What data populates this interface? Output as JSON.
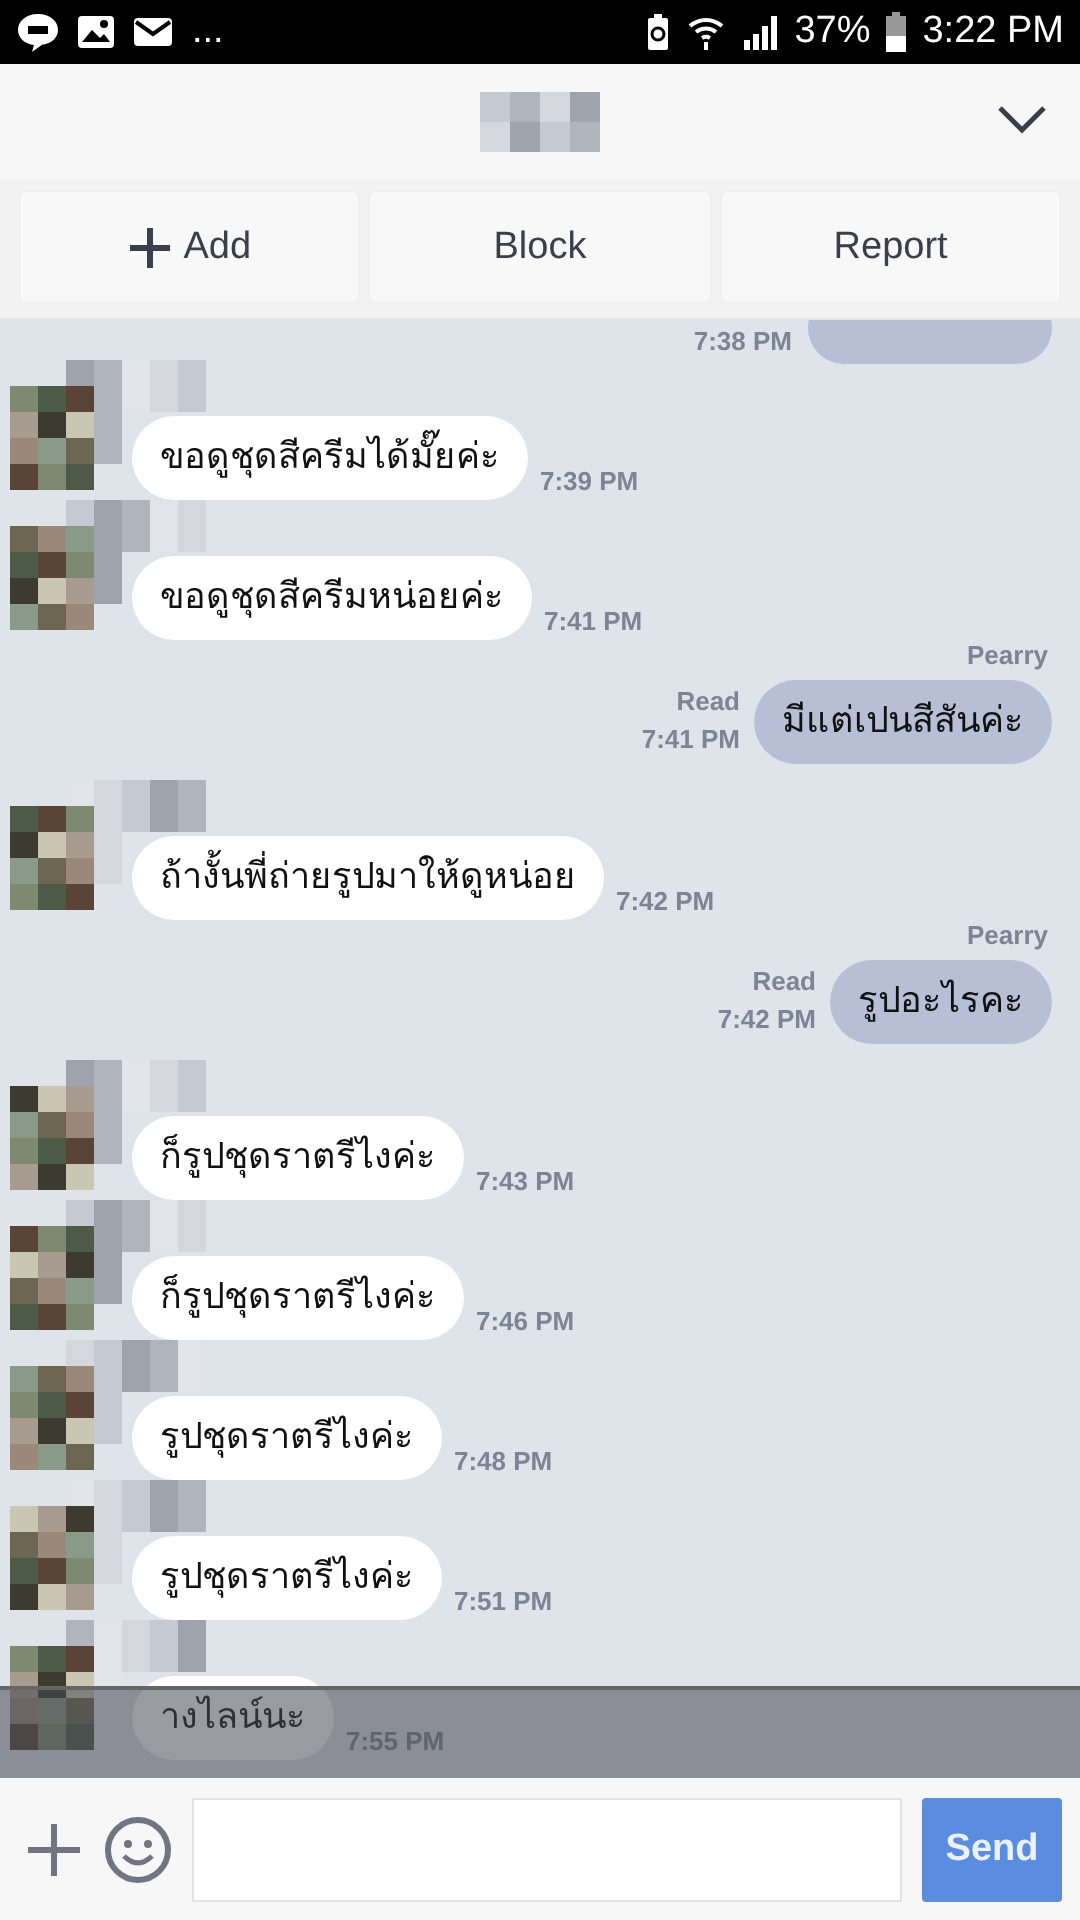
{
  "status_bar": {
    "overflow": "...",
    "battery": "37%",
    "time": "3:22 PM"
  },
  "actions": [
    {
      "kind": "add",
      "label": "Add"
    },
    {
      "kind": "plain",
      "label": "Block"
    },
    {
      "kind": "plain",
      "label": "Report"
    }
  ],
  "messages": [
    {
      "kind": "partial",
      "time": "7:38 PM"
    },
    {
      "kind": "received",
      "text": "ขอดูชุดสีครีมได้มั๊ยค่ะ",
      "time": "7:39 PM"
    },
    {
      "kind": "received",
      "text": "ขอดูชุดสีครีมหน่อยค่ะ",
      "time": "7:41 PM"
    },
    {
      "kind": "sent",
      "sender": "Pearry",
      "read": "Read",
      "time": "7:41 PM",
      "text": "มีแต่เปนสีสันค่ะ"
    },
    {
      "kind": "received",
      "text": "ถ้างั้นพี่ถ่ายรูปมาให้ดูหน่อย",
      "time": "7:42 PM"
    },
    {
      "kind": "sent",
      "sender": "Pearry",
      "read": "Read",
      "time": "7:42 PM",
      "text": "รูปอะไรคะ"
    },
    {
      "kind": "received",
      "text": "ก็รูปชุดราตรีไงค่ะ",
      "time": "7:43 PM"
    },
    {
      "kind": "received",
      "text": "ก็รูปชุดราตรีไงค่ะ",
      "time": "7:46 PM"
    },
    {
      "kind": "received",
      "text": "รูปชุดราตรีไงค่ะ",
      "time": "7:48 PM"
    },
    {
      "kind": "received",
      "text": "รูปชุดราตรีไงค่ะ",
      "time": "7:51 PM"
    },
    {
      "kind": "received",
      "text": "างไลน์นะ",
      "time": "7:55 PM",
      "covered": true
    }
  ],
  "composer": {
    "button": "Send"
  }
}
